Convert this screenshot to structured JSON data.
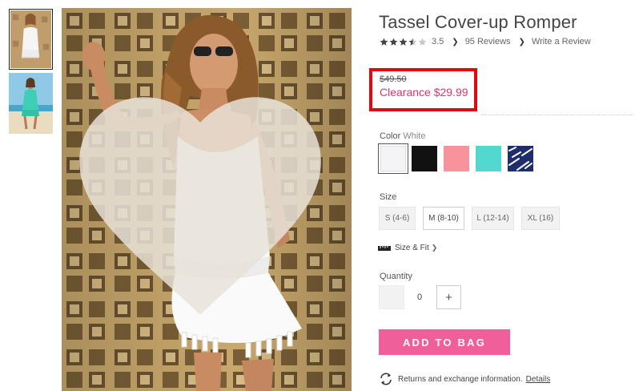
{
  "product": {
    "title": "Tassel Cover-up Romper",
    "rating_value": "3.5",
    "rating_stars": 3.5,
    "reviews_link": "95 Reviews",
    "write_review_link": "Write a Review",
    "review_chevron": "❯"
  },
  "price": {
    "original": "$49.50",
    "clearance": "Clearance $29.99",
    "highlight_color": "#e30613",
    "clearance_color": "#e0336b"
  },
  "color": {
    "label": "Color",
    "selected_name": "White",
    "swatches": [
      {
        "name": "White",
        "hex": "#f4f4f6",
        "selected": true
      },
      {
        "name": "Black",
        "hex": "#111111",
        "selected": false
      },
      {
        "name": "Pink",
        "hex": "#f7949b",
        "selected": false
      },
      {
        "name": "Turquoise",
        "hex": "#52d8cf",
        "selected": false
      },
      {
        "name": "Navy Print",
        "hex": "#1f2e6b",
        "selected": false
      }
    ]
  },
  "size": {
    "label": "Size",
    "options": [
      {
        "label": "S (4-6)",
        "selected": false
      },
      {
        "label": "M (8-10)",
        "selected": true
      },
      {
        "label": "L (12-14)",
        "selected": false
      },
      {
        "label": "XL (16)",
        "selected": false
      }
    ],
    "size_fit_link": "Size & Fit",
    "size_fit_chevron": "❯"
  },
  "quantity": {
    "label": "Quantity",
    "value": "0",
    "plus": "+"
  },
  "cart": {
    "add_label": "ADD TO BAG",
    "button_color": "#ef5f9a"
  },
  "returns": {
    "text": "Returns and exchange information.",
    "details_link": "Details"
  },
  "icons": {
    "heart": "heart-icon",
    "star": "star-icon",
    "ruler": "ruler-icon",
    "returns": "refresh-icon"
  }
}
